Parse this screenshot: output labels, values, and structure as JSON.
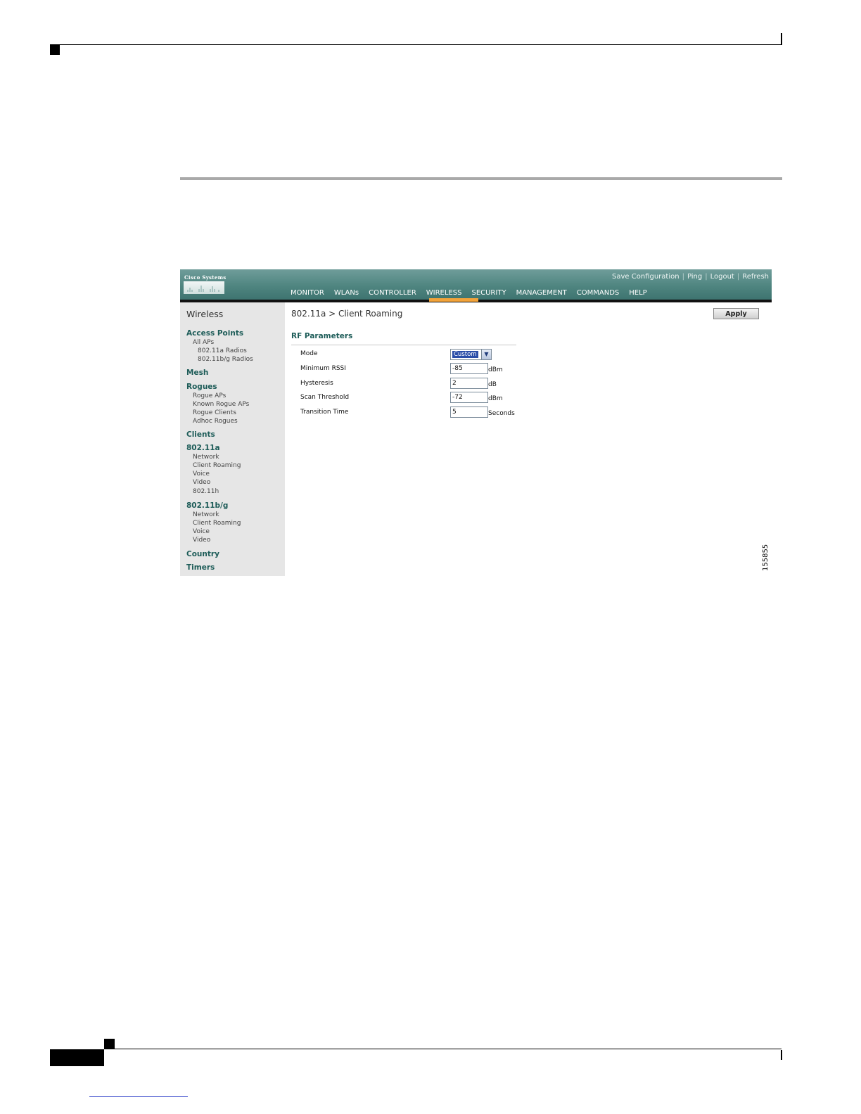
{
  "header": {
    "logo_text": "Cisco Systems",
    "top_links": [
      "Save Configuration",
      "Ping",
      "Logout",
      "Refresh"
    ],
    "nav": [
      "MONITOR",
      "WLANs",
      "CONTROLLER",
      "WIRELESS",
      "SECURITY",
      "MANAGEMENT",
      "COMMANDS",
      "HELP"
    ],
    "active_nav": "WIRELESS",
    "accent_color": "#f2a33a",
    "header_color": "#4f8580"
  },
  "sidebar": {
    "title": "Wireless",
    "access_points": "Access Points",
    "all_aps": "All APs",
    "radios_a": "802.11a Radios",
    "radios_bg": "802.11b/g Radios",
    "mesh": "Mesh",
    "rogues": "Rogues",
    "rogue_items": [
      "Rogue APs",
      "Known Rogue APs",
      "Rogue Clients",
      "Adhoc Rogues"
    ],
    "clients": "Clients",
    "a_title": "802.11a",
    "a_items": [
      "Network",
      "Client Roaming",
      "Voice",
      "Video",
      "802.11h"
    ],
    "bg_title": "802.11b/g",
    "bg_items": [
      "Network",
      "Client Roaming",
      "Voice",
      "Video"
    ],
    "country": "Country",
    "timers": "Timers"
  },
  "main": {
    "breadcrumb": "802.11a > Client Roaming",
    "apply_label": "Apply",
    "section_title": "RF Parameters",
    "mode_label": "Mode",
    "mode_value": "Custom",
    "min_rssi_label": "Minimum RSSI",
    "min_rssi_value": "-85",
    "min_rssi_unit": "dBm",
    "hysteresis_label": "Hysteresis",
    "hysteresis_value": "2",
    "hysteresis_unit": "dB",
    "scan_label": "Scan Threshold",
    "scan_value": "-72",
    "scan_unit": "dBm",
    "transition_label": "Transition Time",
    "transition_value": "5",
    "transition_unit": "Seconds"
  },
  "figure_number": "155855"
}
